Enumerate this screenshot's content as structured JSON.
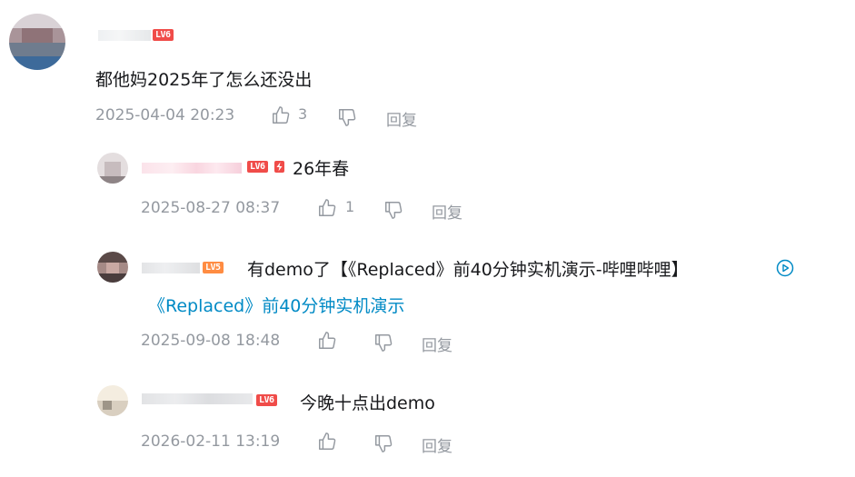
{
  "comments": [
    {
      "level": "LV6",
      "level_color": "#f04c49",
      "text": "都他妈2025年了怎么还没出",
      "time": "2025-04-04 20:23",
      "likes": "3",
      "reply_label": "回复",
      "replies": [
        {
          "level": "LV6",
          "level_color": "#f04c49",
          "has_lightning": true,
          "text": "26年春",
          "time": "2025-08-27 08:37",
          "likes": "1",
          "reply_label": "回复"
        },
        {
          "level": "LV5",
          "level_color": "#ff8c42",
          "text_prefix": "有demo了【《Replaced》前40分钟实机演示-哔哩哔哩】",
          "link_icon": "play-circle-icon",
          "link_text": "《Replaced》前40分钟实机演示",
          "time": "2025-09-08 18:48",
          "likes": "",
          "reply_label": "回复"
        },
        {
          "level": "LV6",
          "level_color": "#f04c49",
          "text": "今晚十点出demo",
          "time": "2026-02-11 13:19",
          "likes": "",
          "reply_label": "回复"
        }
      ]
    }
  ],
  "colors": {
    "text": "#18191c",
    "meta": "#9499a0",
    "link": "#008ac5"
  }
}
